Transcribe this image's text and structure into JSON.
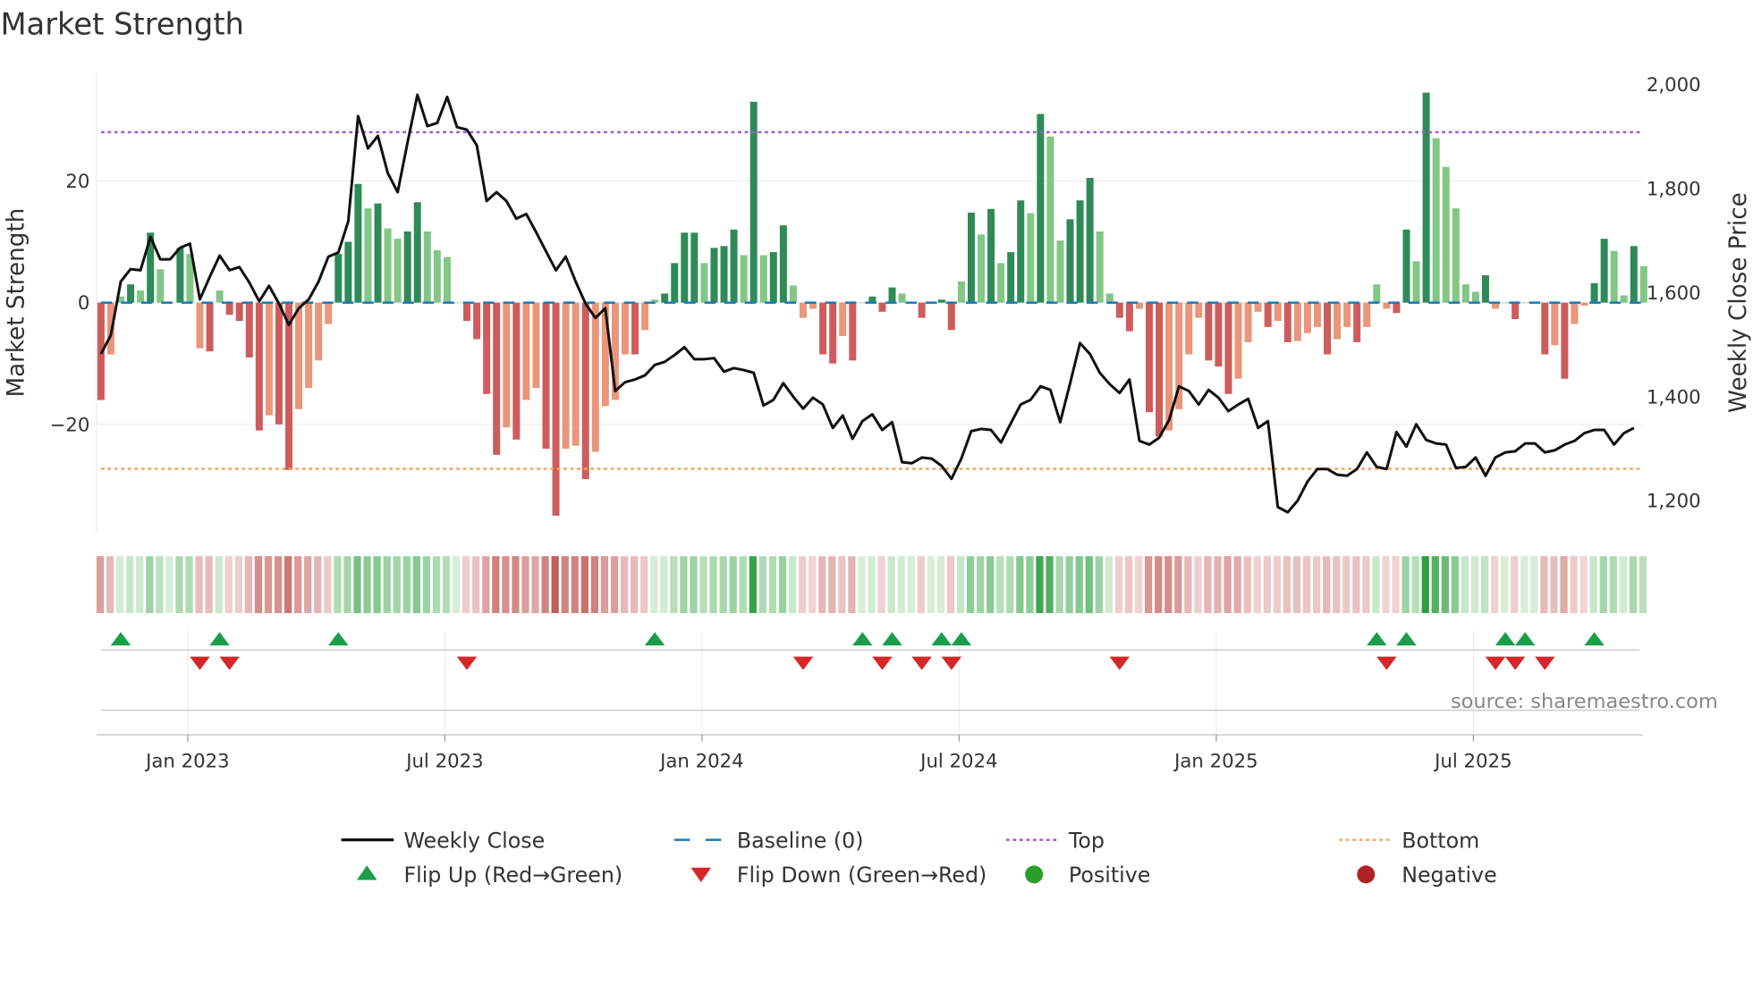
{
  "chart_data": {
    "type": "bar+line",
    "title": "Market Strength",
    "ylabel_left": "Market Strength",
    "ylabel_right": "Weekly Close Price",
    "ylim_left": [
      -38,
      38
    ],
    "ylim_right": [
      1130,
      2020
    ],
    "left_ticks": [
      {
        "v": 20,
        "label": "20"
      },
      {
        "v": 0,
        "label": "0"
      },
      {
        "v": -20,
        "label": "−20"
      }
    ],
    "right_ticks": [
      {
        "v": 2000,
        "label": "2,000"
      },
      {
        "v": 1800,
        "label": "1,800"
      },
      {
        "v": 1600,
        "label": "1,600"
      },
      {
        "v": 1400,
        "label": "1,400"
      },
      {
        "v": 1200,
        "label": "1,200"
      }
    ],
    "x_ticks": [
      {
        "week": 9,
        "label": "Jan 2023"
      },
      {
        "week": 35,
        "label": "Jul 2023"
      },
      {
        "week": 61,
        "label": "Jan 2024"
      },
      {
        "week": 87,
        "label": "Jul 2024"
      },
      {
        "week": 113,
        "label": "Jan 2025"
      },
      {
        "week": 139,
        "label": "Jul 2025"
      }
    ],
    "top_level": 28,
    "bottom_level": -27.3,
    "baseline": 0,
    "strength": [
      -16,
      -8.5,
      1,
      3,
      2,
      11.5,
      5.5,
      0,
      9,
      8,
      -7.5,
      -8,
      2,
      -2,
      -3,
      -9,
      -21,
      -18.5,
      -20,
      -27.5,
      -17.5,
      -14,
      -9.5,
      -3.5,
      8,
      10,
      19.5,
      15.5,
      16.3,
      12.2,
      10.5,
      11.7,
      16.5,
      11.7,
      8.6,
      7.5,
      0,
      -3,
      -6,
      -15,
      -25,
      -20.5,
      -22.5,
      -16,
      -14,
      -24,
      -35,
      -24,
      -23.5,
      -29,
      -24.5,
      -17,
      -16,
      -8.5,
      -8.5,
      -4.5,
      0.5,
      1.5,
      6.5,
      11.5,
      11.5,
      6.5,
      9,
      9.3,
      12,
      7.8,
      33,
      7.8,
      8.3,
      12.7,
      2.8,
      -2.5,
      -1,
      -8.5,
      -10,
      -5.5,
      -9.5,
      0,
      1,
      -1.5,
      2.5,
      1.5,
      0,
      -2.5,
      0,
      0.5,
      -4.5,
      3.5,
      14.8,
      11.2,
      15.4,
      6.5,
      8.3,
      16.8,
      14.7,
      31,
      27.3,
      10.2,
      13.7,
      16.8,
      20.5,
      11.7,
      1.5,
      -2.5,
      -4.7,
      -1,
      -18,
      -22,
      -21,
      -17.5,
      -8.5,
      -2.5,
      -9.5,
      -10.5,
      -15,
      -12.5,
      -6.5,
      -1.5,
      -4,
      -3,
      -6.5,
      -6.3,
      -5,
      -4,
      -8.5,
      -6,
      -4,
      -6.5,
      -4,
      3,
      -1,
      -1.7,
      12,
      6.8,
      34.5,
      27,
      22.3,
      15.5,
      3,
      1.8,
      4.5,
      -1,
      0,
      -2.7,
      0,
      0,
      -8.5,
      -7,
      -12.5,
      -3.5,
      -0.5,
      3.2,
      10.5,
      8.5,
      1.2,
      9.3,
      6
    ],
    "weekly_close": [
      1482,
      1518,
      1621,
      1645,
      1643,
      1707,
      1664,
      1664,
      1686,
      1694,
      1587,
      1630,
      1671,
      1643,
      1649,
      1619,
      1583,
      1613,
      1579,
      1538,
      1570,
      1587,
      1621,
      1669,
      1677,
      1737,
      1939,
      1877,
      1901,
      1830,
      1793,
      1888,
      1980,
      1920,
      1926,
      1976,
      1918,
      1913,
      1883,
      1776,
      1793,
      1776,
      1742,
      1751,
      1716,
      1679,
      1643,
      1669,
      1621,
      1579,
      1551,
      1570,
      1411,
      1428,
      1433,
      1441,
      1461,
      1467,
      1480,
      1495,
      1472,
      1472,
      1474,
      1448,
      1455,
      1451,
      1446,
      1383,
      1394,
      1426,
      1400,
      1377,
      1398,
      1385,
      1340,
      1364,
      1319,
      1353,
      1366,
      1336,
      1351,
      1274,
      1272,
      1283,
      1281,
      1267,
      1242,
      1281,
      1334,
      1338,
      1336,
      1312,
      1349,
      1385,
      1394,
      1420,
      1413,
      1351,
      1426,
      1503,
      1482,
      1446,
      1424,
      1407,
      1433,
      1315,
      1308,
      1321,
      1355,
      1420,
      1411,
      1385,
      1413,
      1398,
      1372,
      1385,
      1396,
      1340,
      1353,
      1188,
      1178,
      1200,
      1237,
      1261,
      1261,
      1250,
      1248,
      1261,
      1293,
      1265,
      1261,
      1332,
      1304,
      1347,
      1317,
      1310,
      1308,
      1263,
      1265,
      1283,
      1248,
      1283,
      1293,
      1295,
      1310,
      1310,
      1293,
      1297,
      1308,
      1315,
      1330,
      1336,
      1336,
      1308,
      1330,
      1340
    ],
    "flip_up_weeks": [
      2,
      12,
      24,
      56,
      77,
      80,
      85,
      87,
      129,
      132,
      142,
      144,
      151
    ],
    "flip_down_weeks": [
      10,
      13,
      37,
      71,
      79,
      83,
      86,
      103,
      130,
      141,
      143,
      146
    ],
    "colors": {
      "pos_dark": "#2e8b57",
      "pos_light": "#82c785",
      "neg_dark": "#cd5c5c",
      "neg_light": "#e9967a",
      "line": "#111111",
      "baseline": "#1f77b4",
      "top": "#9a5fd6",
      "bottom": "#f4a460",
      "flip_up": "#1a9e4a",
      "flip_down": "#d62728",
      "positive": "#2a9d2a",
      "negative": "#b22222"
    },
    "legend": [
      {
        "label": "Weekly Close",
        "kind": "line"
      },
      {
        "label": "Baseline (0)",
        "kind": "dash"
      },
      {
        "label": "Top",
        "kind": "dot-top"
      },
      {
        "label": "Bottom",
        "kind": "dot-bottom"
      },
      {
        "label": "Flip Up (Red→Green)",
        "kind": "tri-up"
      },
      {
        "label": "Flip Down (Green→Red)",
        "kind": "tri-down"
      },
      {
        "label": "Positive",
        "kind": "circle-pos"
      },
      {
        "label": "Negative",
        "kind": "circle-neg"
      }
    ],
    "legend_placement": "bottom"
  },
  "source": "source: sharemaestro.com"
}
